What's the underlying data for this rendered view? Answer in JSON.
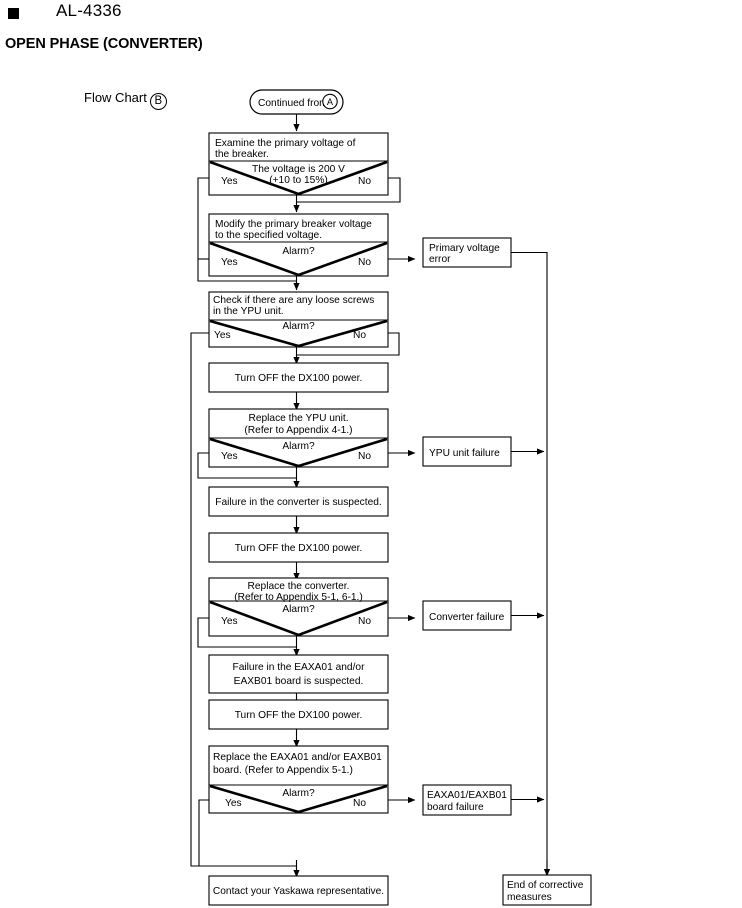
{
  "header": {
    "bullet_icon": "filled-square-icon",
    "alarm_code": "AL-4336",
    "title": "OPEN PHASE (CONVERTER)",
    "flow_chart_label": "Flow Chart",
    "flow_chart_ref": "B"
  },
  "entry": {
    "label": "Continued from",
    "ref": "A"
  },
  "nodes": {
    "n1_text": "Examine the primary voltage of the breaker.",
    "n1_cond_line1": "The voltage is 200 V",
    "n1_cond_line2": "(+10 to 15%)",
    "n2_text": "Modify the primary breaker voltage to the specified voltage.",
    "n2_cond": "Alarm?",
    "n3_text": "Check if there are any loose screws in the YPU unit.",
    "n3_cond": "Alarm?",
    "n4_text": "Turn OFF the DX100 power.",
    "n5_text_line1": "Replace the YPU unit.",
    "n5_text_line2": "(Refer to Appendix 4-1.)",
    "n5_cond": "Alarm?",
    "n6_text": "Failure in the converter is suspected.",
    "n7_text": "Turn OFF the DX100 power.",
    "n8_text_line1": "Replace the converter.",
    "n8_text_line2": "(Refer to Appendix 5-1, 6-1.)",
    "n8_cond": "Alarm?",
    "n9_text_line1": "Failure in the EAXA01 and/or",
    "n9_text_line2": "EAXB01 board is suspected.",
    "n10_text": "Turn OFF the DX100 power.",
    "n11_text_line1": "Replace the EAXA01 and/or EAXB01",
    "n11_text_line2": "board. (Refer to Appendix 5-1.)",
    "n11_cond": "Alarm?",
    "n12_text": "Contact your Yaskawa representative."
  },
  "branch_labels": {
    "yes": "Yes",
    "no": "No"
  },
  "results": {
    "r1": "Primary voltage error",
    "r1_line1": "Primary voltage",
    "r1_line2": "error",
    "r2": "YPU unit failure",
    "r3": "Converter failure",
    "r4_line1": "EAXA01/EAXB01",
    "r4_line2": "board failure",
    "end_line1": "End of corrective",
    "end_line2": "measures"
  },
  "colors": {
    "stroke": "#000000",
    "fill": "#ffffff",
    "text": "#000000"
  }
}
